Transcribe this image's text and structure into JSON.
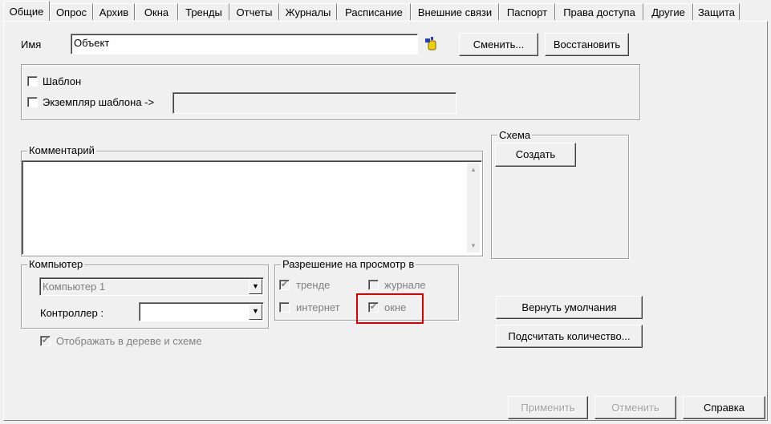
{
  "tabs": [
    {
      "label": "Общие",
      "active": true
    },
    {
      "label": "Опрос"
    },
    {
      "label": "Архив"
    },
    {
      "label": "Окна"
    },
    {
      "label": "Тренды"
    },
    {
      "label": "Отчеты"
    },
    {
      "label": "Журналы"
    },
    {
      "label": "Расписание"
    },
    {
      "label": "Внешние связи"
    },
    {
      "label": "Паспорт"
    },
    {
      "label": "Права доступа"
    },
    {
      "label": "Другие"
    },
    {
      "label": "Защита"
    }
  ],
  "name": {
    "label": "Имя",
    "value": "Объект",
    "change_button": "Сменить...",
    "restore_button": "Восстановить"
  },
  "template": {
    "template_label": "Шаблон",
    "instance_label": "Экземпляр шаблона ->",
    "instance_value": ""
  },
  "comment": {
    "label": "Комментарий",
    "value": ""
  },
  "schema": {
    "label": "Схема",
    "create_button": "Создать"
  },
  "computer": {
    "label": "Компьютер",
    "computer_value": "Компьютер 1",
    "controller_label": "Контроллер :",
    "controller_value": ""
  },
  "view_permission": {
    "label": "Разрешение на просмотр в",
    "trend": {
      "label": "тренде",
      "checked": true
    },
    "journal": {
      "label": "журнале",
      "checked": false
    },
    "internet": {
      "label": "интернет",
      "checked": false
    },
    "window": {
      "label": "окне",
      "checked": true
    }
  },
  "show_in_tree": {
    "label": "Отображать в дереве и схеме",
    "checked": true
  },
  "buttons": {
    "defaults": "Вернуть умолчания",
    "count": "Подсчитать количество...",
    "apply": "Применить",
    "cancel": "Отменить",
    "help": "Справка"
  },
  "colors": {
    "highlight": "#e00000",
    "background": "#f0f0f0"
  }
}
